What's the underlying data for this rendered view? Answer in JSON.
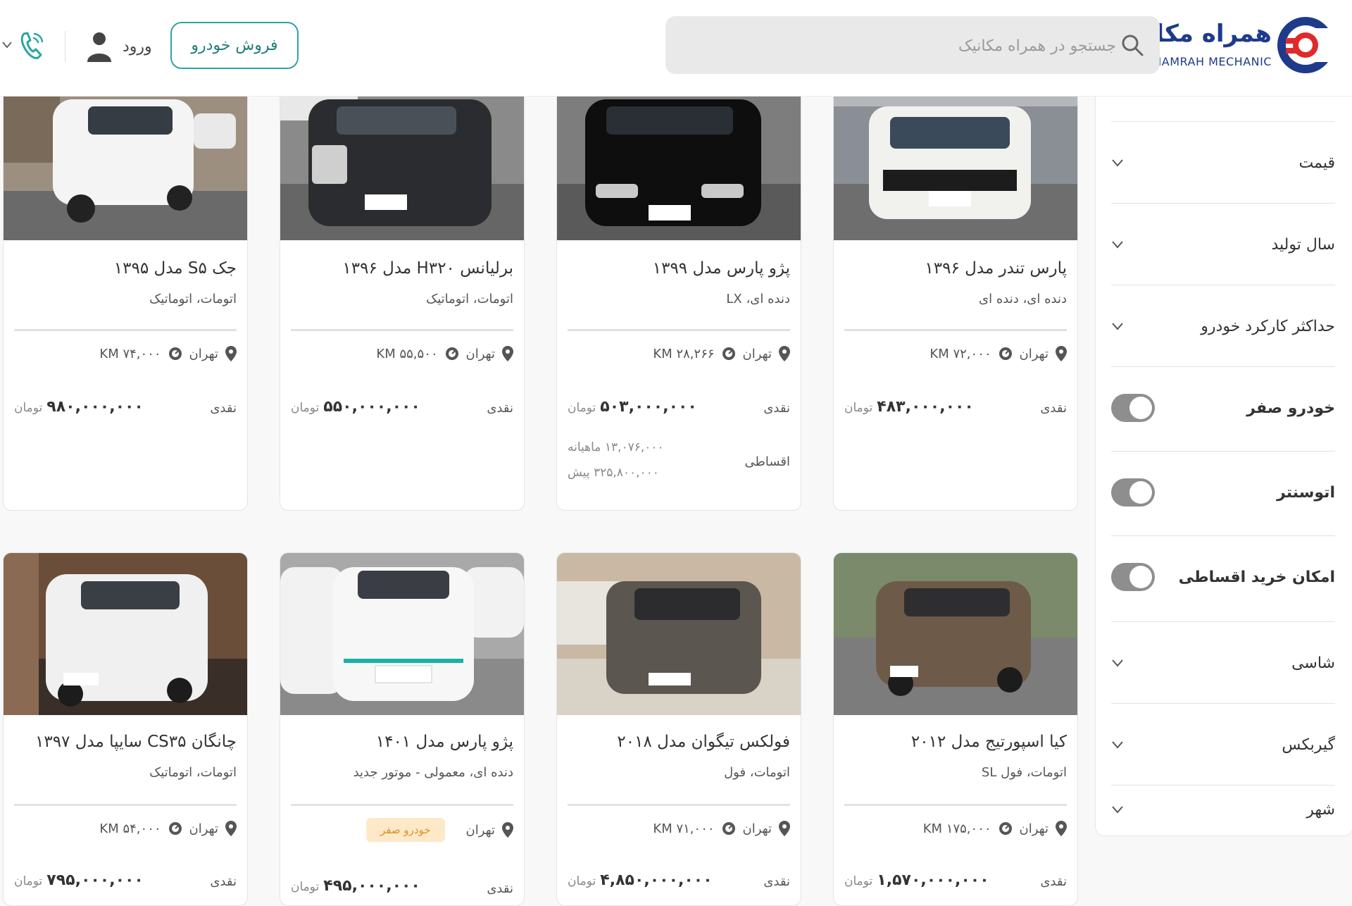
{
  "header": {
    "logo_fa": "همراه مکانیک",
    "logo_en": "HAMRAH MECHANIC",
    "search_placeholder": "جستجو در همراه مکانیک",
    "sell_button": "فروش خودرو",
    "login_label": "ورود",
    "brand_colors": {
      "blue": "#1d3b8a",
      "red": "#e02a2a",
      "teal": "#2aa6a0"
    }
  },
  "filters": [
    {
      "label": "قیمت",
      "type": "dropdown"
    },
    {
      "label": "سال تولید",
      "type": "dropdown"
    },
    {
      "label": "حداکثر کارکرد خودرو",
      "type": "dropdown"
    },
    {
      "label": "خودرو صفر",
      "type": "toggle",
      "on": false
    },
    {
      "label": "اتوسنتر",
      "type": "toggle",
      "on": false
    },
    {
      "label": "امکان خرید اقساطی",
      "type": "toggle",
      "on": false
    },
    {
      "label": "شاسی",
      "type": "dropdown"
    },
    {
      "label": "گیربکس",
      "type": "dropdown"
    },
    {
      "label": "شهر",
      "type": "dropdown"
    }
  ],
  "cars": [
    {
      "title": "پارس تندر مدل ۱۳۹۶",
      "subtitle": "دنده ای، دنده ای",
      "city": "تهران",
      "mileage": "۷۲,۰۰۰ KM",
      "pay_label": "نقدی",
      "price": "۴۸۳,۰۰۰,۰۰۰",
      "currency": "تومان"
    },
    {
      "title": "پژو پارس مدل ۱۳۹۹",
      "subtitle": "دنده ای، LX",
      "city": "تهران",
      "mileage": "۲۸,۲۶۶ KM",
      "pay_label": "نقدی",
      "price": "۵۰۳,۰۰۰,۰۰۰",
      "currency": "تومان",
      "installment_label": "اقساطی",
      "monthly": "۱۳,۰۷۶,۰۰۰ ماهیانه",
      "down_payment": "۳۲۵,۸۰۰,۰۰۰ پیش"
    },
    {
      "title": "برلیانس H۳۲۰ مدل ۱۳۹۶",
      "subtitle": "اتومات، اتوماتیک",
      "city": "تهران",
      "mileage": "۵۵,۵۰۰ KM",
      "pay_label": "نقدی",
      "price": "۵۵۰,۰۰۰,۰۰۰",
      "currency": "تومان"
    },
    {
      "title": "جک S۵ مدل ۱۳۹۵",
      "subtitle": "اتومات، اتوماتیک",
      "city": "تهران",
      "mileage": "۷۴,۰۰۰ KM",
      "pay_label": "نقدی",
      "price": "۹۸۰,۰۰۰,۰۰۰",
      "currency": "تومان"
    },
    {
      "title": "کیا اسپورتیج مدل ۲۰۱۲",
      "subtitle": "اتومات، فول SL",
      "city": "تهران",
      "mileage": "۱۷۵,۰۰۰ KM",
      "pay_label": "نقدی",
      "price": "۱,۵۷۰,۰۰۰,۰۰۰",
      "currency": "تومان"
    },
    {
      "title": "فولکس تیگوان مدل ۲۰۱۸",
      "subtitle": "اتومات، فول",
      "city": "تهران",
      "mileage": "۷۱,۰۰۰ KM",
      "pay_label": "نقدی",
      "price": "۴,۸۵۰,۰۰۰,۰۰۰",
      "currency": "تومان"
    },
    {
      "title": "پژو پارس مدل ۱۴۰۱",
      "subtitle": "دنده ای، معمولی - موتور جدید",
      "city": "تهران",
      "badge": "خودرو صفر",
      "pay_label": "نقدی",
      "price": "۴۹۵,۰۰۰,۰۰۰",
      "currency": "تومان"
    },
    {
      "title": "چانگان CS۳۵ سایپا مدل ۱۳۹۷",
      "subtitle": "اتومات، اتوماتیک",
      "city": "تهران",
      "mileage": "۵۴,۰۰۰ KM",
      "pay_label": "نقدی",
      "price": "۷۹۵,۰۰۰,۰۰۰",
      "currency": "تومان"
    }
  ]
}
